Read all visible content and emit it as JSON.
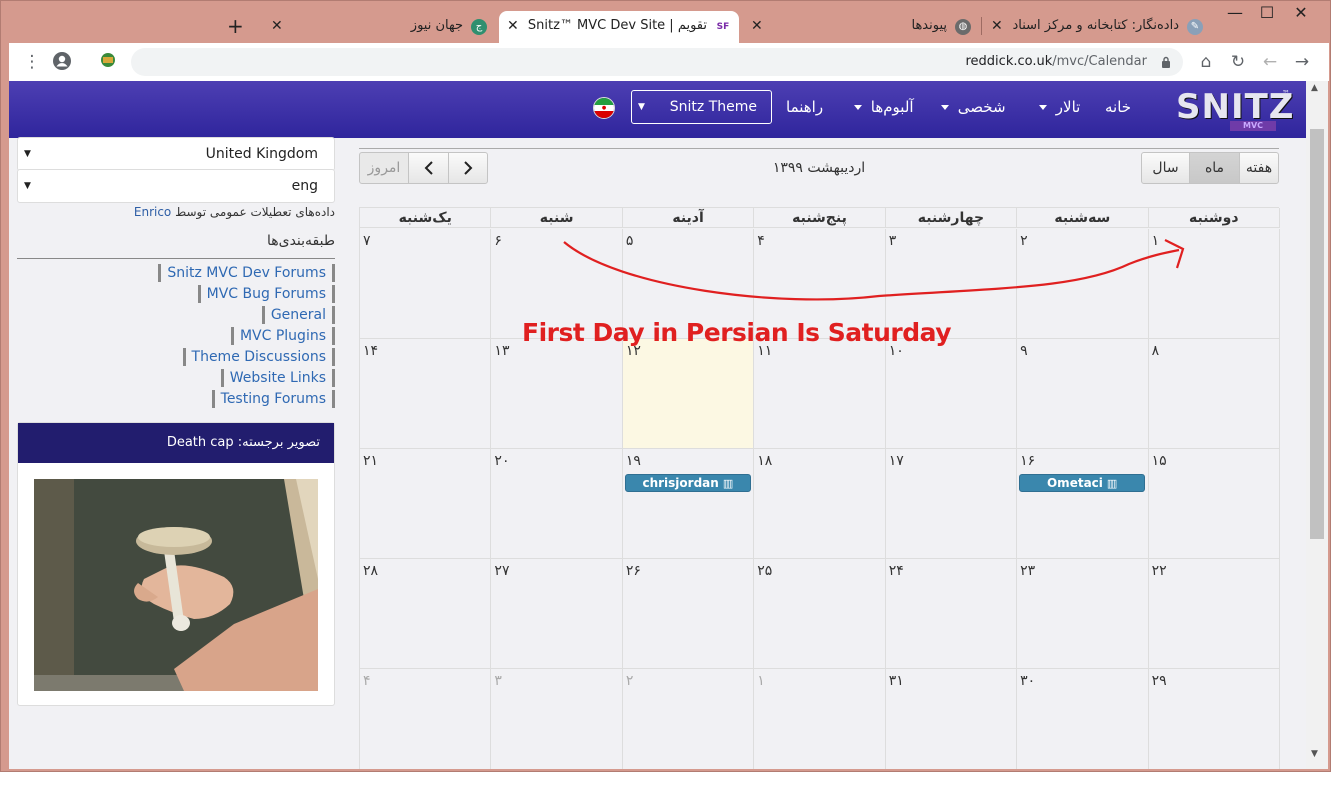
{
  "browser": {
    "tabs": [
      {
        "title": "داده‌نگار: کتابخانه و مرکز اسناد",
        "active": false
      },
      {
        "title": "پیوندها",
        "active": false
      },
      {
        "title": "تقویم | Snitz™ MVC Dev Site",
        "active": true
      },
      {
        "title": "جهان نیوز",
        "active": false
      }
    ],
    "new_tab": "+",
    "close": "✕",
    "window_controls": {
      "minimize": "—",
      "maximize": "☐",
      "close": "✕"
    },
    "url_host": "reddick.co.uk",
    "url_path": "/mvc/Calendar",
    "icons": {
      "back": "arrow-left-icon",
      "forward": "arrow-right-icon",
      "reload": "reload-icon",
      "home": "home-icon",
      "star": "star-icon",
      "profile": "profile-icon",
      "menu": "kebab-menu-icon",
      "lock": "lock-icon"
    }
  },
  "navbar": {
    "logo": "SNITZ",
    "logo_sub": "MVC",
    "logo_tm": "™",
    "links": [
      "خانه",
      "تالار",
      "شخصی",
      "آلبوم‌ها",
      "راهنما"
    ],
    "theme_select": "Snitz Theme",
    "colors": {
      "gradient_top": "#4d3fb3",
      "gradient_bottom": "#2f259c"
    }
  },
  "sidebar": {
    "country_select": "United Kingdom",
    "language_select": "eng",
    "holiday_text": "داده‌های تعطیلات عمومی توسط",
    "holiday_author": "Enrico",
    "categories_heading": "طبقه‌بندی‌ها",
    "forums": [
      "Snitz MVC Dev Forums",
      "MVC Bug Forums",
      "General",
      "MVC Plugins",
      "Theme Discussions",
      "Website Links",
      "Testing Forums"
    ],
    "photo_heading": "تصویر برجسته: Death cap"
  },
  "calendar": {
    "title": "اردیبهشت ۱۳۹۹",
    "views": [
      "هفته",
      "ماه",
      "سال"
    ],
    "active_view": "ماه",
    "today_button": "امروز",
    "prev": "‹",
    "next": "›",
    "day_names": [
      "دوشنبه",
      "سه‌شنبه",
      "چهارشنبه",
      "پنج‌شنبه",
      "آدینه",
      "شنبه",
      "یک‌شنبه"
    ],
    "weeks": [
      [
        "۱",
        "۲",
        "۳",
        "۴",
        "۵",
        "۶",
        "۷"
      ],
      [
        "۸",
        "۹",
        "۱۰",
        "۱۱",
        "۱۲",
        "۱۳",
        "۱۴"
      ],
      [
        "۱۵",
        "۱۶",
        "۱۷",
        "۱۸",
        "۱۹",
        "۲۰",
        "۲۱"
      ],
      [
        "۲۲",
        "۲۳",
        "۲۴",
        "۲۵",
        "۲۶",
        "۲۷",
        "۲۸"
      ],
      [
        "۲۹",
        "۳۰",
        "۳۱",
        "۱",
        "۲",
        "۳",
        "۴"
      ]
    ],
    "today": "۱۲",
    "events": [
      {
        "day": "۱۶",
        "label": "Ometaci"
      },
      {
        "day": "۱۹",
        "label": "chrisjordan"
      }
    ],
    "annotation": "First Day in Persian Is Saturday",
    "annotation_color": "#e02020"
  }
}
